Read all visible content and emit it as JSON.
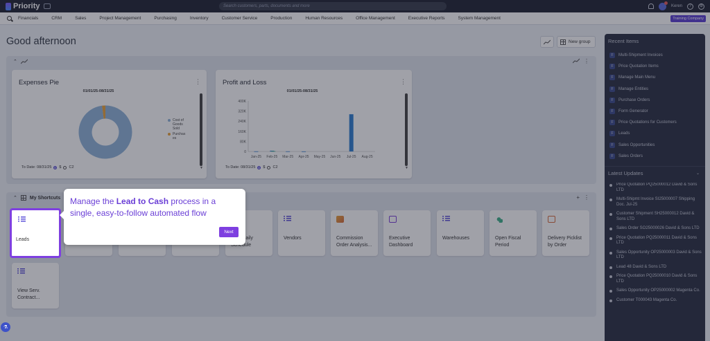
{
  "app": {
    "name": "Priority",
    "search_placeholder": "Search customers, parts, documents and more",
    "user_name": "Keren",
    "company": "Training Company"
  },
  "menu": [
    "Financials",
    "CRM",
    "Sales",
    "Project Management",
    "Purchasing",
    "Inventory",
    "Customer Service",
    "Production",
    "Human Resources",
    "Office Management",
    "Executive Reports",
    "System Management"
  ],
  "greeting": "Good afternoon",
  "new_group_label": "New group",
  "expenses_card": {
    "title": "Expenses Pie",
    "range": "01/01/25-08/31/25",
    "to_date": "To Date: 08/31/25",
    "currency1": "$",
    "currency2": "C2",
    "legend": [
      {
        "label": "Cost of Goods Sold",
        "color": "#8fb3d9"
      },
      {
        "label": "Purchases",
        "color": "#e8a33c"
      }
    ]
  },
  "profit_card": {
    "title": "Profit and Loss",
    "range": "01/01/25-08/31/25",
    "to_date": "To Date: 08/31/25",
    "currency1": "$",
    "currency2": "C2"
  },
  "chart_data": [
    {
      "type": "pie",
      "title": "Expenses Pie",
      "categories": [
        "Cost of Goods Sold",
        "Purchases"
      ],
      "values": [
        98,
        2
      ]
    },
    {
      "type": "bar",
      "title": "Profit and Loss",
      "categories": [
        "Jan-25",
        "Feb-25",
        "Mar-25",
        "Apr-25",
        "May-25",
        "Jun-25",
        "Jul-25",
        "Aug-25"
      ],
      "series": [
        {
          "values": [
            1000,
            6000,
            1000,
            500,
            0,
            0,
            295000,
            0
          ],
          "color": "#2f7fd1"
        },
        {
          "values": [
            0,
            3000,
            0,
            0,
            0,
            0,
            0,
            0
          ],
          "color": "#3fb08a"
        }
      ],
      "yticks": [
        "0",
        "80K",
        "160K",
        "240K",
        "320K",
        "400K"
      ],
      "ylim": [
        0,
        400000
      ]
    }
  ],
  "shortcuts": {
    "title": "My Shortcuts",
    "tiles": [
      {
        "label": "Leads",
        "icon": "list-icon"
      },
      {
        "label": "",
        "icon": ""
      },
      {
        "label": "",
        "icon": ""
      },
      {
        "label": "",
        "icon": ""
      },
      {
        "label": "Proj. Daily Schedule",
        "icon": "list-icon"
      },
      {
        "label": "Vendors",
        "icon": "list-icon"
      },
      {
        "label": "Commission Order Analysis...",
        "icon": "report-icon"
      },
      {
        "label": "Executive Dashboard",
        "icon": "dashboard-icon"
      },
      {
        "label": "Warehouses",
        "icon": "list-icon"
      },
      {
        "label": "Open Fiscal Period",
        "icon": "procedure-icon"
      },
      {
        "label": "Delivery Picklist by Order",
        "icon": "document-icon"
      },
      {
        "label": "View Serv. Contract...",
        "icon": "list-icon"
      }
    ]
  },
  "tooltip": {
    "text_pre": "Manage the ",
    "text_bold": "Lead to Cash",
    "text_post": " process in a single, easy-to-follow automated flow",
    "next": "Next"
  },
  "recent": {
    "title": "Recent Items",
    "badge": "F",
    "items": [
      "Multi-Shipment Invoices",
      "Price Quotation Items",
      "Manage Main Menu",
      "Manage Entities",
      "Purchase Orders",
      "Form Generator",
      "Price Quotations for Customers",
      "Leads",
      "Sales Opportunities",
      "Sales Orders"
    ]
  },
  "updates": {
    "title": "Latest Updates",
    "items": [
      "Price Quotation PQ25000012 David & Sons LTD",
      "Multi-Shipmt Invoice SI25000007 Shipping Doc. Jul-25",
      "Customer Shipment SH25000012 David & Sons LTD",
      "Sales Order SO25000026 David & Sons LTD",
      "Price Quotation PQ25000011 David & Sons LTD",
      "Sales Opportunity OP25000003 David & Sons LTD",
      "Lead 48 David & Sons LTD",
      "Price Quotation PQ25000010 David & Sons LTD",
      "Sales Opportunity OP25000002 Magenta Co.",
      "Customer T000043 Magenta Co."
    ]
  }
}
